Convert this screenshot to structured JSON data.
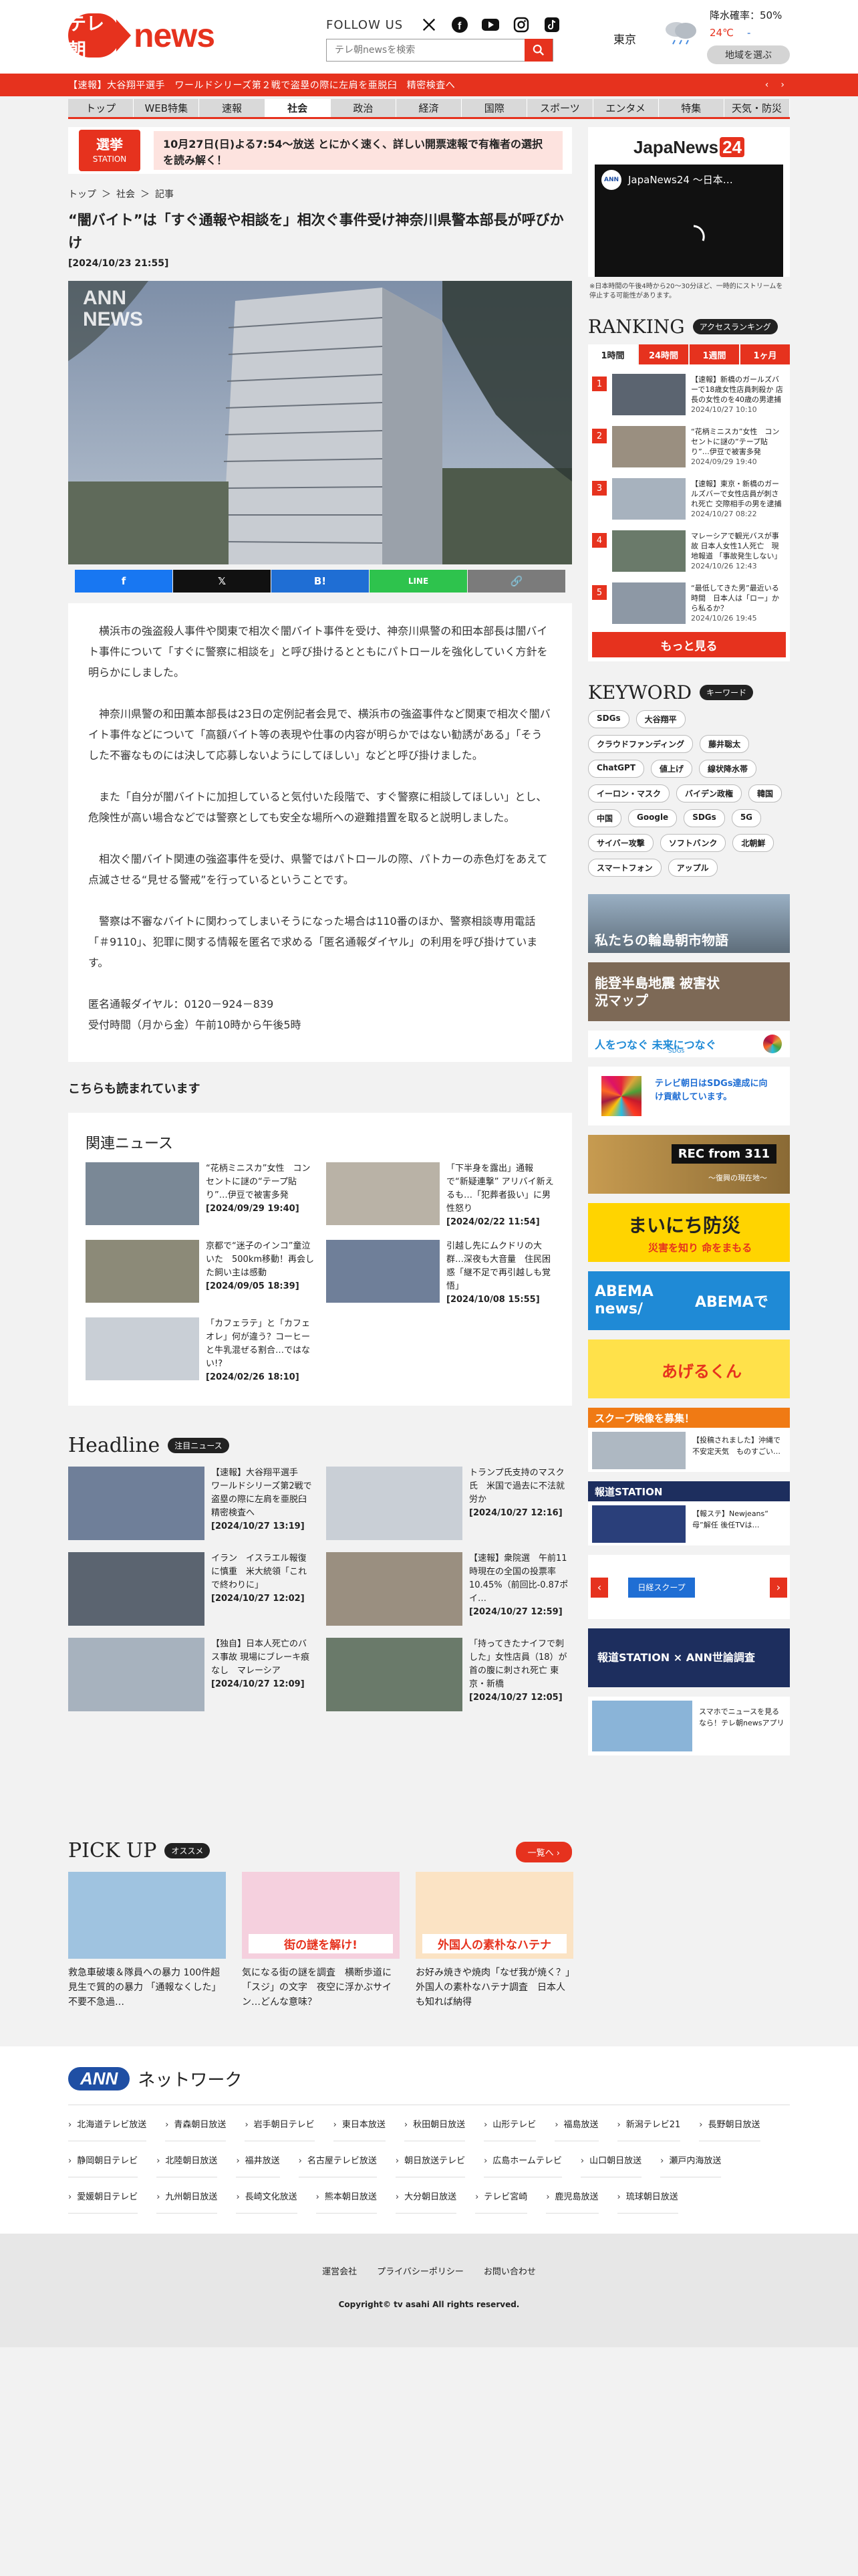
{
  "header": {
    "logo_mark": "テレ朝",
    "logo_text": "news",
    "follow_label": "FOLLOW US",
    "search_placeholder": "テレ朝newsを検索",
    "weather": {
      "city": "東京",
      "rain_label": "降水確率：",
      "rain_value": "50%",
      "temp_high": "24℃",
      "temp_low": "-",
      "region_button": "地域を選ぶ"
    }
  },
  "breaking": {
    "text": "【速報】大谷翔平選手　ワールドシリーズ第２戦で盗塁の際に左肩を亜脱臼　精密検査へ",
    "prev": "‹",
    "next": "›"
  },
  "nav": {
    "items": [
      "トップ",
      "WEB特集",
      "速報",
      "社会",
      "政治",
      "経済",
      "国際",
      "スポーツ",
      "エンタメ",
      "特集",
      "天気・防災"
    ],
    "active": "社会"
  },
  "election": {
    "logo_line1": "選挙",
    "logo_line2": "STATION",
    "text": "10月27日(日)よる7:54～放送 とにかく速く、詳しい開票速報で有権者の選択を読み解く！"
  },
  "breadcrumb": [
    "トップ",
    "＞",
    "社会",
    "＞",
    "記事"
  ],
  "article": {
    "title": "“闇バイト”は「すぐ通報や相談を」相次ぐ事件受け神奈川県警本部長が呼びかけ",
    "date": "[2024/10/23 21:55]",
    "photo_label": "ANN NEWS",
    "paragraphs": [
      "横浜市の強盗殺人事件や関東で相次ぐ闇バイト事件を受け、神奈川県警の和田本部長は闇バイト事件について「すぐに警察に相談を」と呼び掛けるとともにパトロールを強化していく方針を明らかにしました。",
      "神奈川県警の和田薫本部長は23日の定例記者会見で、横浜市の強盗事件など関東で相次ぐ闇バイト事件などについて「高額バイト等の表現や仕事の内容が明らかではない勧誘がある」「そうした不審なものには決して応募しないようにしてほしい」などと呼び掛けました。",
      "また「自分が闇バイトに加担していると気付いた段階で、すぐ警察に相談してほしい」とし、危険性が高い場合などでは警察としても安全な場所への避難措置を取ると説明しました。",
      "相次ぐ闇バイト関連の強盗事件を受け、県警ではパトロールの際、パトカーの赤色灯をあえて点滅させる“見せる警戒”を行っているということです。",
      "警察は不審なバイトに関わってしまいそうになった場合は110番のほか、警察相談専用電話「＃9110」、犯罪に関する情報を匿名で求める「匿名通報ダイヤル」の利用を呼び掛けています。"
    ],
    "contact_line1": "匿名通報ダイヤル：0120－924－839",
    "contact_line2": "受付時間（月から金）午前10時から午後5時"
  },
  "share": [
    "f",
    "𝕏",
    "B!",
    "LINE",
    "🔗"
  ],
  "read_more": "こちらも読まれています",
  "related": {
    "heading": "関連ニュース",
    "items": [
      {
        "title": "“花柄ミニスカ”女性　コンセントに謎の“テープ貼り”…伊豆で被害多発",
        "date": "[2024/09/29 19:40]"
      },
      {
        "title": "「下半身を露出」通報で“新疑連撃” アリバイ新えるも…「犯葬者扱い」に男性怒り",
        "date": "[2024/02/22 11:54]"
      },
      {
        "title": "京都で“迷子のインコ”童泣いた　500km移動！再会した飼い主は感動",
        "date": "[2024/09/05 18:39]"
      },
      {
        "title": "引越し先にムクドリの大群…深夜も大音量　住民困惑「継不足で再引越しも覚悟」",
        "date": "[2024/10/08 15:55]"
      },
      {
        "title": "「カフェラテ」と「カフェオレ」何が違う？コーヒーと牛乳混ぜる割合…ではない!?",
        "date": "[2024/02/26 18:10]"
      }
    ]
  },
  "headline": {
    "title": "Headline",
    "badge": "注目ニュース",
    "items": [
      {
        "title": "【速報】大谷翔平選手　ワールドシリーズ第2戦で盗塁の際に左肩を亜脱臼　精密検査へ",
        "date": "[2024/10/27 13:19]"
      },
      {
        "title": "トランプ氏支持のマスク氏　米国で過去に不法就労か",
        "date": "[2024/10/27 12:16]"
      },
      {
        "title": "イラン　イスラエル報復に慎重　米大統領「これで終わりに」",
        "date": "[2024/10/27 12:02]"
      },
      {
        "title": "【速報】衆院選　午前11時現在の全国の投票率10.45%（前回比-0.87ポイ…",
        "date": "[2024/10/27 12:59]"
      },
      {
        "title": "【独自】日本人死亡のバス事故 現場にブレーキ痕なし　マレーシア",
        "date": "[2024/10/27 12:09]"
      },
      {
        "title": "「持ってきたナイフで刺した」女性店員（18）が首の腹に刺され死亡 東京・新橋",
        "date": "[2024/10/27 12:05]"
      }
    ]
  },
  "pickup": {
    "title": "PICK UP",
    "badge": "オススメ",
    "more": "一覧へ ›",
    "items": [
      {
        "caption": "救急車破壊＆隊員への暴力 100件超 見生で質的の暴力 「通報なくした」不要不急過…",
        "img_text": ""
      },
      {
        "caption": "気になる街の謎を調査　横断歩道に「スジ」の文字　夜空に浮かぶサイン…どんな意味？",
        "img_text": "街の謎を解け!"
      },
      {
        "caption": "お好み焼きや焼肉「なぜ我が焼く？」外国人の素朴なハテナ調査　日本人も知れば納得",
        "img_text": "外国人の素朴なハテナ"
      }
    ]
  },
  "network": {
    "logo": "ANN",
    "title": "ネットワーク",
    "stations": [
      "北海道テレビ放送",
      "青森朝日放送",
      "岩手朝日テレビ",
      "東日本放送",
      "秋田朝日放送",
      "山形テレビ",
      "福島放送",
      "新潟テレビ21",
      "長野朝日放送",
      "静岡朝日テレビ",
      "北陸朝日放送",
      "福井放送",
      "名古屋テレビ放送",
      "朝日放送テレビ",
      "広島ホームテレビ",
      "山口朝日放送",
      "瀬戸内海放送",
      "愛媛朝日テレビ",
      "九州朝日放送",
      "長崎文化放送",
      "熊本朝日放送",
      "大分朝日放送",
      "テレビ宮崎",
      "鹿児島放送",
      "琉球朝日放送"
    ]
  },
  "footer": {
    "links": [
      "運営会社",
      "プライバシーポリシー",
      "お問い合わせ"
    ],
    "copyright": "Copyright© tv asahi All rights reserved."
  },
  "sidebar": {
    "jn24": {
      "logo": "JapaNews",
      "logo_num": "24",
      "video_title": "JapaNews24 ～日本…",
      "note": "※日本時間の午後4時から20～30分ほど、一時的にストリームを停止する可能性があります。"
    },
    "ranking": {
      "title": "RANKING",
      "badge": "アクセスランキング",
      "tabs": [
        "1時間",
        "24時間",
        "1週間",
        "1ヶ月"
      ],
      "items": [
        {
          "num": "1",
          "title": "【速報】新橋のガールズバーで18歳女性店員刺殺か 店長の女性のを40歳の男逮捕",
          "date": "2024/10/27 10:10"
        },
        {
          "num": "2",
          "title": "“花柄ミニスカ”女性　コンセントに謎の“テープ貼り”…伊豆で被害多発",
          "date": "2024/09/29 19:40"
        },
        {
          "num": "3",
          "title": "【速報】東京・新橋のガールズバーで女性店員が刺され死亡 交際相手の男を逮捕",
          "date": "2024/10/27 08:22"
        },
        {
          "num": "4",
          "title": "マレーシアで観光バスが事故 日本人女性1人死亡　現地報道 「事故発生しない」",
          "date": "2024/10/26 12:43"
        },
        {
          "num": "5",
          "title": "“最低してきた男”最近いる時間　日本人は「ロー」から私るか？",
          "date": "2024/10/26 19:45"
        }
      ],
      "more": "もっと見る"
    },
    "keyword": {
      "title": "KEYWORD",
      "badge": "キーワード",
      "items": [
        "SDGs",
        "大谷翔平",
        "クラウドファンディング",
        "藤井聡太",
        "ChatGPT",
        "値上げ",
        "線状降水帯",
        "イーロン・マスク",
        "バイデン政権",
        "韓国",
        "中国",
        "Google",
        "SDGs",
        "5G",
        "サイバー攻撃",
        "ソフトバンク",
        "北朝鮮",
        "スマートフォン",
        "アップル"
      ]
    },
    "banners": {
      "wajima": "私たちの輪島朝市物語",
      "noto": "能登半島地震 被害状況マップ",
      "sdgs": "人をつなぐ 未来につなぐ",
      "sdgs_sub": "SDGs",
      "sdgs2": "テレビ朝日はSDGs達成に向け貢献しています。",
      "rec311": "REC from 311",
      "rec_sub": "～復興の現在地～",
      "bousai": "まいにち防災",
      "bousai_sub": "災害を知り 命をまもる",
      "abema": "ABEMA news/",
      "abema_sub": "ABEMAで",
      "agerun": "あげるくん",
      "scoop": "スクープ映像を募集！",
      "scoop_sub": "【投稿されました】沖縄で不安定天気　ものすごい…",
      "hodo": "報道STATION",
      "hodo_sub": "【報ステ】Newjeans“ 母”解任 後任TVは…",
      "nikkei": "日経スクープ",
      "ann_hodo": "報道STATION × ANN世論調査",
      "app": "スマホでニュースを見るなら！テレ朝newsアプリ"
    }
  },
  "colors": {
    "brand": "#e6321e",
    "bg": "#f2f2f2"
  }
}
